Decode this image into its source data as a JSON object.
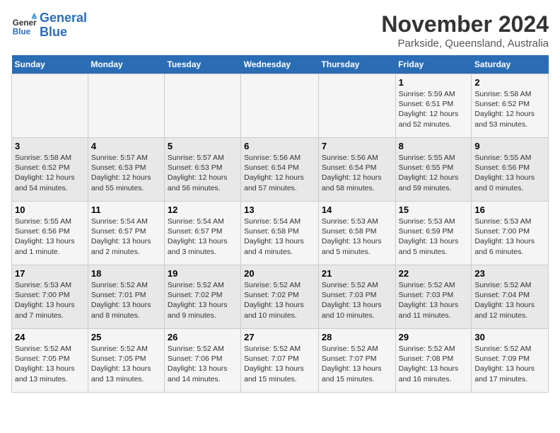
{
  "header": {
    "logo_line1": "General",
    "logo_line2": "Blue",
    "month": "November 2024",
    "location": "Parkside, Queensland, Australia"
  },
  "weekdays": [
    "Sunday",
    "Monday",
    "Tuesday",
    "Wednesday",
    "Thursday",
    "Friday",
    "Saturday"
  ],
  "weeks": [
    [
      {
        "day": "",
        "info": ""
      },
      {
        "day": "",
        "info": ""
      },
      {
        "day": "",
        "info": ""
      },
      {
        "day": "",
        "info": ""
      },
      {
        "day": "",
        "info": ""
      },
      {
        "day": "1",
        "info": "Sunrise: 5:59 AM\nSunset: 6:51 PM\nDaylight: 12 hours\nand 52 minutes."
      },
      {
        "day": "2",
        "info": "Sunrise: 5:58 AM\nSunset: 6:52 PM\nDaylight: 12 hours\nand 53 minutes."
      }
    ],
    [
      {
        "day": "3",
        "info": "Sunrise: 5:58 AM\nSunset: 6:52 PM\nDaylight: 12 hours\nand 54 minutes."
      },
      {
        "day": "4",
        "info": "Sunrise: 5:57 AM\nSunset: 6:53 PM\nDaylight: 12 hours\nand 55 minutes."
      },
      {
        "day": "5",
        "info": "Sunrise: 5:57 AM\nSunset: 6:53 PM\nDaylight: 12 hours\nand 56 minutes."
      },
      {
        "day": "6",
        "info": "Sunrise: 5:56 AM\nSunset: 6:54 PM\nDaylight: 12 hours\nand 57 minutes."
      },
      {
        "day": "7",
        "info": "Sunrise: 5:56 AM\nSunset: 6:54 PM\nDaylight: 12 hours\nand 58 minutes."
      },
      {
        "day": "8",
        "info": "Sunrise: 5:55 AM\nSunset: 6:55 PM\nDaylight: 12 hours\nand 59 minutes."
      },
      {
        "day": "9",
        "info": "Sunrise: 5:55 AM\nSunset: 6:56 PM\nDaylight: 13 hours\nand 0 minutes."
      }
    ],
    [
      {
        "day": "10",
        "info": "Sunrise: 5:55 AM\nSunset: 6:56 PM\nDaylight: 13 hours\nand 1 minute."
      },
      {
        "day": "11",
        "info": "Sunrise: 5:54 AM\nSunset: 6:57 PM\nDaylight: 13 hours\nand 2 minutes."
      },
      {
        "day": "12",
        "info": "Sunrise: 5:54 AM\nSunset: 6:57 PM\nDaylight: 13 hours\nand 3 minutes."
      },
      {
        "day": "13",
        "info": "Sunrise: 5:54 AM\nSunset: 6:58 PM\nDaylight: 13 hours\nand 4 minutes."
      },
      {
        "day": "14",
        "info": "Sunrise: 5:53 AM\nSunset: 6:58 PM\nDaylight: 13 hours\nand 5 minutes."
      },
      {
        "day": "15",
        "info": "Sunrise: 5:53 AM\nSunset: 6:59 PM\nDaylight: 13 hours\nand 5 minutes."
      },
      {
        "day": "16",
        "info": "Sunrise: 5:53 AM\nSunset: 7:00 PM\nDaylight: 13 hours\nand 6 minutes."
      }
    ],
    [
      {
        "day": "17",
        "info": "Sunrise: 5:53 AM\nSunset: 7:00 PM\nDaylight: 13 hours\nand 7 minutes."
      },
      {
        "day": "18",
        "info": "Sunrise: 5:52 AM\nSunset: 7:01 PM\nDaylight: 13 hours\nand 8 minutes."
      },
      {
        "day": "19",
        "info": "Sunrise: 5:52 AM\nSunset: 7:02 PM\nDaylight: 13 hours\nand 9 minutes."
      },
      {
        "day": "20",
        "info": "Sunrise: 5:52 AM\nSunset: 7:02 PM\nDaylight: 13 hours\nand 10 minutes."
      },
      {
        "day": "21",
        "info": "Sunrise: 5:52 AM\nSunset: 7:03 PM\nDaylight: 13 hours\nand 10 minutes."
      },
      {
        "day": "22",
        "info": "Sunrise: 5:52 AM\nSunset: 7:03 PM\nDaylight: 13 hours\nand 11 minutes."
      },
      {
        "day": "23",
        "info": "Sunrise: 5:52 AM\nSunset: 7:04 PM\nDaylight: 13 hours\nand 12 minutes."
      }
    ],
    [
      {
        "day": "24",
        "info": "Sunrise: 5:52 AM\nSunset: 7:05 PM\nDaylight: 13 hours\nand 13 minutes."
      },
      {
        "day": "25",
        "info": "Sunrise: 5:52 AM\nSunset: 7:05 PM\nDaylight: 13 hours\nand 13 minutes."
      },
      {
        "day": "26",
        "info": "Sunrise: 5:52 AM\nSunset: 7:06 PM\nDaylight: 13 hours\nand 14 minutes."
      },
      {
        "day": "27",
        "info": "Sunrise: 5:52 AM\nSunset: 7:07 PM\nDaylight: 13 hours\nand 15 minutes."
      },
      {
        "day": "28",
        "info": "Sunrise: 5:52 AM\nSunset: 7:07 PM\nDaylight: 13 hours\nand 15 minutes."
      },
      {
        "day": "29",
        "info": "Sunrise: 5:52 AM\nSunset: 7:08 PM\nDaylight: 13 hours\nand 16 minutes."
      },
      {
        "day": "30",
        "info": "Sunrise: 5:52 AM\nSunset: 7:09 PM\nDaylight: 13 hours\nand 17 minutes."
      }
    ]
  ]
}
